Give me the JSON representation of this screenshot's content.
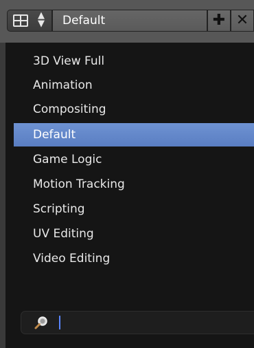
{
  "header": {
    "layout_name": "Default",
    "add_symbol": "✚",
    "close_symbol": "✕"
  },
  "menu": {
    "items": [
      {
        "label": "3D View Full"
      },
      {
        "label": "Animation"
      },
      {
        "label": "Compositing"
      },
      {
        "label": "Default",
        "selected": true
      },
      {
        "label": "Game Logic"
      },
      {
        "label": "Motion Tracking"
      },
      {
        "label": "Scripting"
      },
      {
        "label": "UV Editing"
      },
      {
        "label": "Video Editing"
      }
    ]
  },
  "search": {
    "value": ""
  },
  "colors": {
    "accent": "#5a7ec2",
    "caret": "#5a86ff"
  }
}
